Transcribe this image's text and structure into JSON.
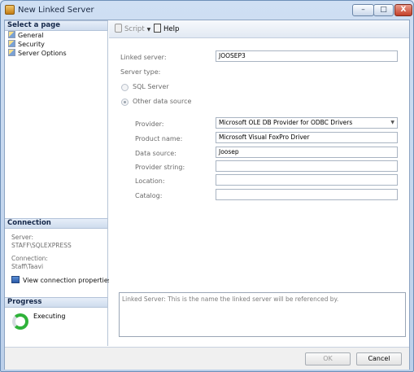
{
  "window": {
    "title": "New Linked Server"
  },
  "titlebar_buttons": {
    "minimize": "–",
    "maximize": "□",
    "close": "X"
  },
  "left_panel": {
    "select_page_header": "Select a page",
    "pages": [
      {
        "label": "General"
      },
      {
        "label": "Security"
      },
      {
        "label": "Server Options"
      }
    ],
    "connection_header": "Connection",
    "server_label": "Server:",
    "server_value": "STAFF\\SQLEXPRESS",
    "connection_label": "Connection:",
    "connection_value": "Staff\\Taavi",
    "view_connection_properties": "View connection properties",
    "progress_header": "Progress",
    "progress_status": "Executing"
  },
  "toolbar": {
    "script_label": "Script",
    "help_label": "Help"
  },
  "form": {
    "linked_server_label": "Linked server:",
    "linked_server_value": "JOOSEP3",
    "server_type_label": "Server type:",
    "sql_server_label": "SQL Server",
    "other_data_source_label": "Other data source",
    "provider_label": "Provider:",
    "provider_value": "Microsoft OLE DB Provider for ODBC Drivers",
    "product_name_label": "Product name:",
    "product_name_value": "Microsoft Visual FoxPro Driver",
    "data_source_label": "Data source:",
    "data_source_value": "Joosep",
    "provider_string_label": "Provider string:",
    "provider_string_value": "",
    "location_label": "Location:",
    "location_value": "",
    "catalog_label": "Catalog:",
    "catalog_value": ""
  },
  "description_text": "Linked Server: This is the name the linked server will be referenced by.",
  "buttons": {
    "ok": "OK",
    "cancel": "Cancel"
  }
}
